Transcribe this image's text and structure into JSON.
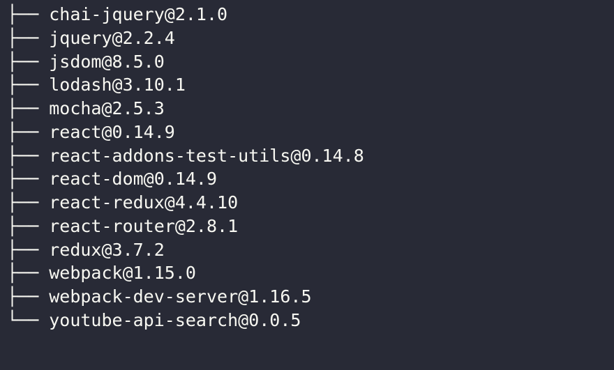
{
  "packages": [
    {
      "prefix": "├── ",
      "text": "chai-jquery@2.1.0"
    },
    {
      "prefix": "├── ",
      "text": "jquery@2.2.4"
    },
    {
      "prefix": "├── ",
      "text": "jsdom@8.5.0"
    },
    {
      "prefix": "├── ",
      "text": "lodash@3.10.1"
    },
    {
      "prefix": "├── ",
      "text": "mocha@2.5.3"
    },
    {
      "prefix": "├── ",
      "text": "react@0.14.9"
    },
    {
      "prefix": "├── ",
      "text": "react-addons-test-utils@0.14.8"
    },
    {
      "prefix": "├── ",
      "text": "react-dom@0.14.9"
    },
    {
      "prefix": "├── ",
      "text": "react-redux@4.4.10"
    },
    {
      "prefix": "├── ",
      "text": "react-router@2.8.1"
    },
    {
      "prefix": "├── ",
      "text": "redux@3.7.2"
    },
    {
      "prefix": "├── ",
      "text": "webpack@1.15.0"
    },
    {
      "prefix": "├── ",
      "text": "webpack-dev-server@1.16.5"
    },
    {
      "prefix": "└── ",
      "text": "youtube-api-search@0.0.5"
    }
  ]
}
